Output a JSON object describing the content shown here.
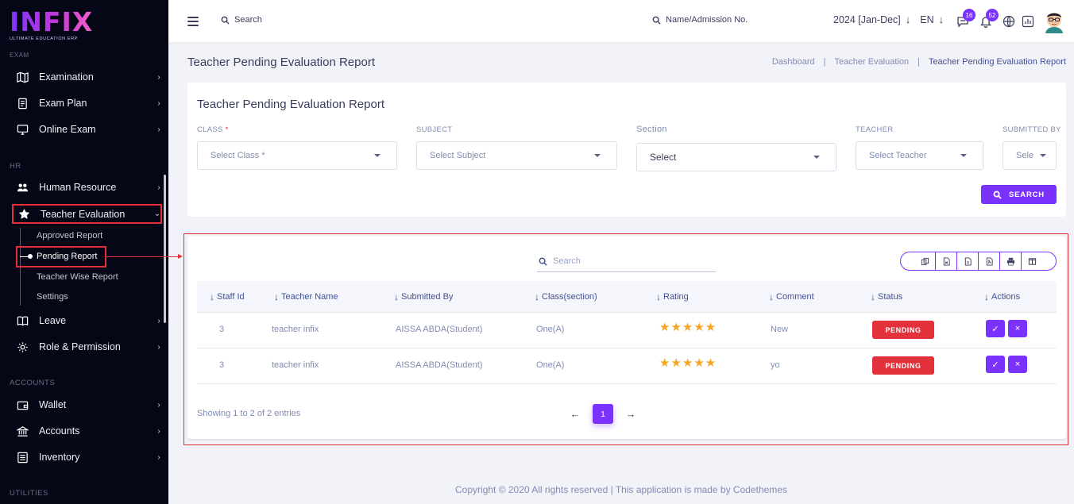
{
  "app": {
    "logo_text": "INFIX",
    "logo_subtitle": "ULTIMATE EDUCATION ERP"
  },
  "sidebar": {
    "cut_label": "EXAM",
    "sections": [
      {
        "label": "HR"
      },
      {
        "label": "ACCOUNTS"
      },
      {
        "label": "UTILITIES"
      }
    ],
    "items": [
      {
        "label": "Examination",
        "icon": "map-icon"
      },
      {
        "label": "Exam Plan",
        "icon": "document-icon"
      },
      {
        "label": "Online Exam",
        "icon": "monitor-icon"
      },
      {
        "label": "Human Resource",
        "icon": "users-icon"
      },
      {
        "label": "Teacher Evaluation",
        "icon": "star-icon",
        "active": true
      },
      {
        "label": "Leave",
        "icon": "book-icon"
      },
      {
        "label": "Role & Permission",
        "icon": "gear-users-icon"
      },
      {
        "label": "Wallet",
        "icon": "wallet-icon"
      },
      {
        "label": "Accounts",
        "icon": "bank-icon"
      },
      {
        "label": "Inventory",
        "icon": "inventory-icon"
      }
    ],
    "submenu": [
      {
        "label": "Approved Report"
      },
      {
        "label": "Pending Report",
        "active": true
      },
      {
        "label": "Teacher Wise Report"
      },
      {
        "label": "Settings"
      }
    ]
  },
  "topbar": {
    "search_label": "Search",
    "admission_search_label": "Name/Admission No.",
    "session": "2024 [Jan-Dec]",
    "language": "EN",
    "messages_count": "16",
    "notifications_count": "52"
  },
  "page": {
    "title": "Teacher Pending Evaluation Report",
    "breadcrumb": [
      "Dashboard",
      "Teacher Evaluation",
      "Teacher Pending Evaluation Report"
    ]
  },
  "criteria": {
    "title": "Teacher Pending Evaluation Report",
    "class_label": "CLASS",
    "class_required": "*",
    "class_placeholder": "Select Class *",
    "subject_label": "SUBJECT",
    "subject_placeholder": "Select Subject",
    "section_label": "Section",
    "section_placeholder": "Select",
    "teacher_label": "TEACHER",
    "teacher_placeholder": "Select Teacher",
    "submitted_by_label": "SUBMITTED BY",
    "submitted_by_placeholder": "Sele",
    "search_button": "SEARCH"
  },
  "table": {
    "search_placeholder": "Search",
    "export_buttons": [
      "copy-icon",
      "csv-icon",
      "excel-icon",
      "pdf-icon",
      "print-icon",
      "columns-icon"
    ],
    "columns": [
      "Staff Id",
      "Teacher Name",
      "Submitted By",
      "Class(section)",
      "Rating",
      "Comment",
      "Status",
      "Actions"
    ],
    "rows": [
      {
        "staff_id": "3",
        "teacher_name": "teacher infix",
        "submitted_by": "AISSA ABDA(Student)",
        "class_section": "One(A)",
        "rating": 5,
        "rating_stars": "★★★★★",
        "comment": "New",
        "status": "PENDING"
      },
      {
        "staff_id": "3",
        "teacher_name": "teacher infix",
        "submitted_by": "AISSA ABDA(Student)",
        "class_section": "One(A)",
        "rating": 5,
        "rating_stars": "★★★★★",
        "comment": "yo",
        "status": "PENDING"
      }
    ],
    "action_approve": "✓",
    "action_reject": "×",
    "showing_text": "Showing 1 to 2 of 2 entries",
    "current_page": "1",
    "prev_arrow": "←",
    "next_arrow": "→"
  },
  "footer": {
    "text": "Copyright © 2020 All rights reserved | This application is made by Codethemes"
  },
  "colors": {
    "accent": "#7c32ff",
    "danger": "#e2313b",
    "sidebar_bg": "#050616",
    "star": "#f5a623"
  }
}
